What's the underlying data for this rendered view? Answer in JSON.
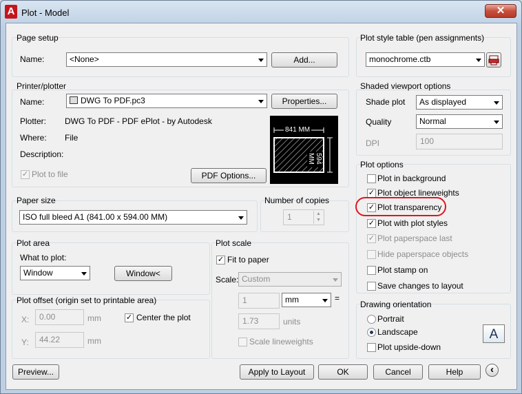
{
  "window": {
    "title": "Plot - Model",
    "app_icon": "A",
    "close": "✕"
  },
  "page_setup": {
    "group": "Page setup",
    "name_label": "Name:",
    "name_value": "<None>",
    "add_button": "Add..."
  },
  "printer": {
    "group": "Printer/plotter",
    "name_label": "Name:",
    "name_value": "DWG To PDF.pc3",
    "properties_button": "Properties...",
    "plotter_label": "Plotter:",
    "plotter_value": "DWG To PDF - PDF ePlot - by Autodesk",
    "where_label": "Where:",
    "where_value": "File",
    "description_label": "Description:",
    "plot_to_file": "Plot to file",
    "pdf_options_button": "PDF Options...",
    "preview_width": "841 MM",
    "preview_height": "594 MM"
  },
  "paper_size": {
    "group": "Paper size",
    "value": "ISO full bleed A1 (841.00 x 594.00 MM)"
  },
  "copies": {
    "group": "Number of copies",
    "value": "1"
  },
  "plot_area": {
    "group": "Plot area",
    "what_label": "What to plot:",
    "what_value": "Window",
    "window_button": "Window<"
  },
  "plot_offset": {
    "group": "Plot offset (origin set to printable area)",
    "x_label": "X:",
    "x_value": "0.00",
    "x_unit": "mm",
    "y_label": "Y:",
    "y_value": "44.22",
    "y_unit": "mm",
    "center": "Center the plot"
  },
  "plot_scale": {
    "group": "Plot scale",
    "fit": "Fit to paper",
    "scale_label": "Scale:",
    "scale_value": "Custom",
    "num": "1",
    "unit_value": "mm",
    "equals": "=",
    "units_num": "1.73",
    "units_label": "units",
    "lineweights": "Scale lineweights"
  },
  "style_table": {
    "group": "Plot style table (pen assignments)",
    "value": "monochrome.ctb"
  },
  "shaded": {
    "group": "Shaded viewport options",
    "shade_label": "Shade plot",
    "shade_value": "As displayed",
    "quality_label": "Quality",
    "quality_value": "Normal",
    "dpi_label": "DPI",
    "dpi_value": "100"
  },
  "plot_options": {
    "group": "Plot options",
    "items": [
      "Plot in background",
      "Plot object lineweights",
      "Plot transparency",
      "Plot with plot styles",
      "Plot paperspace last",
      "Hide paperspace objects",
      "Plot stamp on",
      "Save changes to layout"
    ]
  },
  "orientation": {
    "group": "Drawing orientation",
    "portrait": "Portrait",
    "landscape": "Landscape",
    "upside": "Plot upside-down",
    "icon": "A"
  },
  "footer": {
    "preview": "Preview...",
    "apply": "Apply to Layout",
    "ok": "OK",
    "cancel": "Cancel",
    "help": "Help",
    "more": "‹"
  },
  "colors": {
    "highlight": "#e0141e",
    "close": "#c74f3c"
  }
}
